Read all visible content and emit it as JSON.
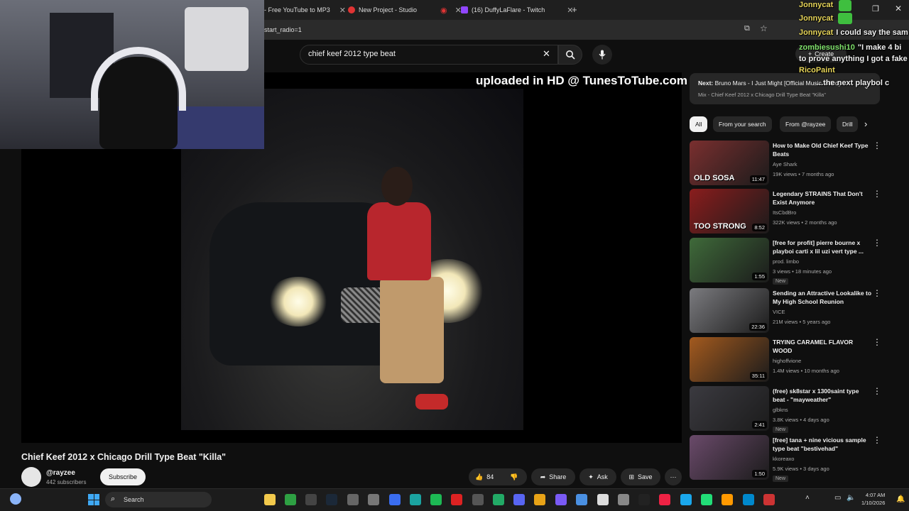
{
  "tabs": [
    {
      "label": "- Free YouTube to MP3",
      "fav_color": "#9aa0a6"
    },
    {
      "label": "New Project - Studio",
      "fav_color": "#e03434"
    },
    {
      "label": "(16) DuffyLaFlare - Twitch",
      "fav_color": "#9146ff"
    }
  ],
  "address": {
    "url_fragment": "start_radio=1"
  },
  "search": {
    "query": "chief keef 2012 type beat"
  },
  "header": {
    "create_label": "Create"
  },
  "player": {
    "watermark": "uploaded in HD @ TunesToTube.com"
  },
  "video": {
    "title": "Chief Keef 2012 x Chicago Drill Type Beat \"Killa\"",
    "channel": "@rayzee",
    "subscribers": "442 subscribers",
    "subscribe_label": "Subscribe",
    "likes": "84",
    "share_label": "Share",
    "ask_label": "Ask",
    "save_label": "Save"
  },
  "next": {
    "label": "Next:",
    "title": "Bruno Mars - I Just Might [Official Music Video]",
    "playlist": "Mix - Chief Keef 2012 x Chicago Drill Type Beat \"Killa\""
  },
  "chips": [
    "All",
    "From your search",
    "From @rayzee",
    "Drill"
  ],
  "recommendations": [
    {
      "title": "How to Make Old Chief Keef Type Beats",
      "channel": "Aye Shark",
      "meta": "19K views • 7 months ago",
      "duration": "11:47",
      "badge": "",
      "caption": "OLD SOSA",
      "color": "#7a2f2f"
    },
    {
      "title": "Legendary STRAINS That Don't Exist Anymore",
      "channel": "ItsCbdBro",
      "meta": "322K views • 2 months ago",
      "duration": "8:52",
      "badge": "",
      "caption": "TOO STRONG",
      "color": "#8a1d1d"
    },
    {
      "title": "[free for profit] pierre bourne x playboi carti x lil uzi vert type ...",
      "channel": "prod. limbo",
      "meta": "3 views • 18 minutes ago",
      "duration": "1:55",
      "badge": "New",
      "caption": "",
      "color": "#3f6a3a"
    },
    {
      "title": "Sending an Attractive Lookalike to My High School Reunion",
      "channel": "VICE",
      "meta": "21M views • 5 years ago",
      "duration": "22:36",
      "badge": "",
      "caption": "",
      "color": "#7b7b7f"
    },
    {
      "title": "TRYING CARAMEL FLAVOR WOOD",
      "channel": "highoffvione",
      "meta": "1.4M views • 10 months ago",
      "duration": "35:11",
      "badge": "",
      "caption": "",
      "color": "#a35a1e"
    },
    {
      "title": "(free) sk8star x 1300saint type beat - \"mayweather\"",
      "channel": "glbkns",
      "meta": "3.8K views • 4 days ago",
      "duration": "2:41",
      "badge": "New",
      "caption": "",
      "color": "#3b3a40"
    },
    {
      "title": "[free] tana + nine vicious sample type beat \"bestivehad\"",
      "channel": "kkoreaxo",
      "meta": "5.9K views • 3 days ago",
      "duration": "1:50",
      "badge": "New",
      "caption": "",
      "color": "#6a4a6a"
    }
  ],
  "chat": [
    {
      "name": "Jonnycat",
      "text": "",
      "green": false
    },
    {
      "name": "Jonnycat",
      "text": "",
      "green": false
    },
    {
      "name": "Jonnycat",
      "text": "I could say the sam",
      "green": false
    },
    {
      "name": "zombiesushi10",
      "text": "\"I make 4 bi",
      "green": true
    },
    {
      "name": "",
      "text": "to prove anything I got a fake",
      "green": false
    },
    {
      "name": "RicoPaint",
      "text": "",
      "green": false
    },
    {
      "name": "",
      "text": "...the next playbol c",
      "green": false
    }
  ],
  "taskbar": {
    "search_label": "Search",
    "time": "4:07 AM",
    "date": "1/10/2026"
  }
}
